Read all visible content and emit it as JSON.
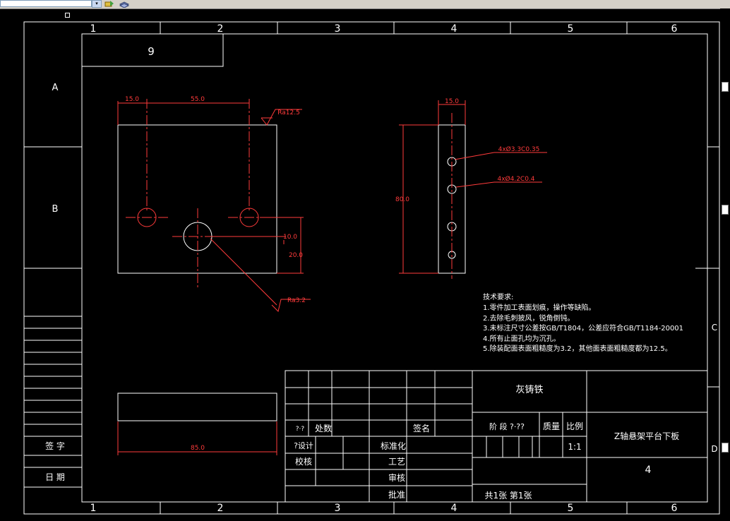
{
  "frame": {
    "col_numbers": [
      "1",
      "2",
      "3",
      "4",
      "5",
      "6"
    ],
    "row_letters": [
      "A",
      "B",
      "C",
      "D"
    ],
    "part_number_box": "9"
  },
  "front_view": {
    "dim_15": "15.0",
    "dim_55": "55.0",
    "rough_top": "Ra12.5",
    "dim_10": "10.0",
    "dim_20": "20.0",
    "rough_bottom": "Ra3.2",
    "dim_85": "85.0"
  },
  "side_view": {
    "dim_15": "15.0",
    "dim_80": "80.0",
    "hole_note_1": "4xØ3.3C0.35",
    "hole_note_2": "4xØ4.2C0.4"
  },
  "tech_req": {
    "heading": "技术要求:",
    "lines": [
      "1.零件加工表面划痕，操作等缺陷。",
      "2.去除毛刺披风，锐角倒钝。",
      "3.未标注尺寸公差按GB/T1804，公差应符合GB/T1184-20001",
      "4.所有止面孔均为沉孔。",
      "5.除装配面表面粗糙度为3.2，其他面表面粗糙度都为12.5。"
    ]
  },
  "left_strip": {
    "sign_label": "签  字",
    "date_label": "日  期"
  },
  "title_block": {
    "material": "灰铸铁",
    "part_name": "Z轴悬架平台下板",
    "count_col_mark": "?·?",
    "count_label": "处数",
    "sign_col_label": "签名",
    "designer_label": "?设计",
    "check_label": "校核",
    "standardize_label": "标准化",
    "craft_label": "工艺",
    "review_label": "审核",
    "approve_label": "批准",
    "stage_label": "阶 段 ?·??",
    "mass_label": "质量",
    "scale_label": "比例",
    "scale_value": "1:1",
    "drawing_number": "4",
    "sheets_label": "共1张  第1张"
  }
}
